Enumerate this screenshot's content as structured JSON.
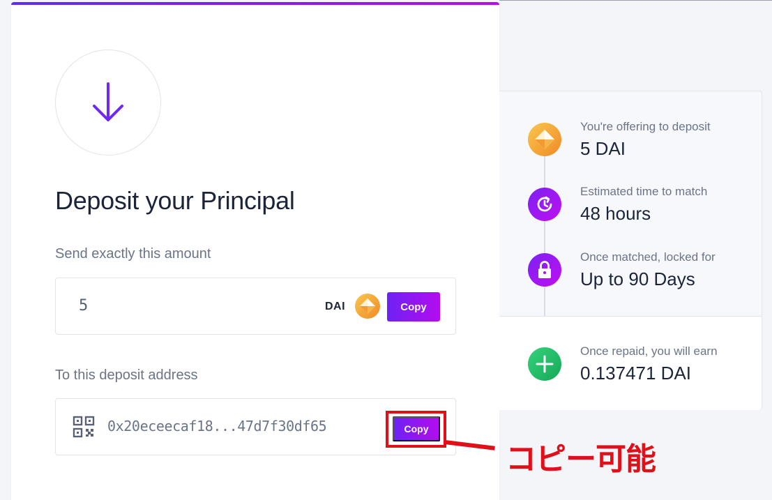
{
  "deposit": {
    "title": "Deposit your Principal",
    "amount_label": "Send exactly this amount",
    "amount_value": "5",
    "currency": "DAI",
    "copy_label": "Copy",
    "address_label": "To this deposit address",
    "address_value": "0x20eceecaf18...47d7f30df65"
  },
  "annotation": {
    "copy_label": "Copy",
    "note": "コピー可能",
    "color": "#e0101a"
  },
  "summary": {
    "items": [
      {
        "label": "You're offering to deposit",
        "value": "5 DAI",
        "icon": "dai-coin-icon"
      },
      {
        "label": "Estimated time to match",
        "value": "48 hours",
        "icon": "clock-icon"
      },
      {
        "label": "Once matched, locked for",
        "value": "Up to 90 Days",
        "icon": "lock-icon"
      }
    ],
    "earn": {
      "label": "Once repaid, you will earn",
      "value": "0.137471 DAI",
      "icon": "plus-icon"
    }
  },
  "colors": {
    "accent": "#6d22f4",
    "accent_end": "#b40cf0",
    "title": "#1b2438",
    "muted": "#6b7486",
    "coin": "#f5ac37",
    "success": "#1fbf68"
  }
}
